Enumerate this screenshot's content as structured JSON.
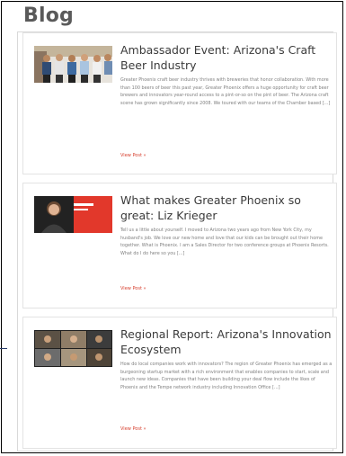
{
  "page": {
    "heading": "Blog"
  },
  "posts": [
    {
      "title": "Ambassador Event: Arizona's Craft Beer Industry",
      "excerpt": "Greater Phoenix craft beer industry thrives with breweries that honor collaboration. With more than 100 beers of beer this past year, Greater Phoenix offers a huge opportunity for craft beer brewers and innovators year-round access to a pint-or-so on the pint of beer. The Arizona craft scene has grown significantly since 2008. We toured with our teams of the Chamber based [...]",
      "more": "View Post »",
      "thumb_icon": "group-photo-icon"
    },
    {
      "title": "What makes Greater Phoenix so great: Liz Krieger",
      "excerpt": "Tell us a little about yourself. I moved to Arizona two years ago from New York City, my husband's job. We love our new home and love that our kids can be brought out their home together. What is Phoenix. I am a Sales Director for two conference groups at Phoenix Resorts. What do I do here so you [...]",
      "more": "View Post »",
      "thumb_icon": "portrait-photo-icon"
    },
    {
      "title": "Regional Report: Arizona's Innovation Ecosystem",
      "excerpt": "How do local companies work with innovators? The region of Greater Phoenix has emerged as a burgeoning startup market with a rich environment that enables companies to start, scale and launch new ideas. Companies that have been building your deal flow include the likes of Phoenix and the Tempe network industry including Innovation Office [...]",
      "more": "View Post »",
      "thumb_icon": "video-call-photo-icon"
    }
  ]
}
